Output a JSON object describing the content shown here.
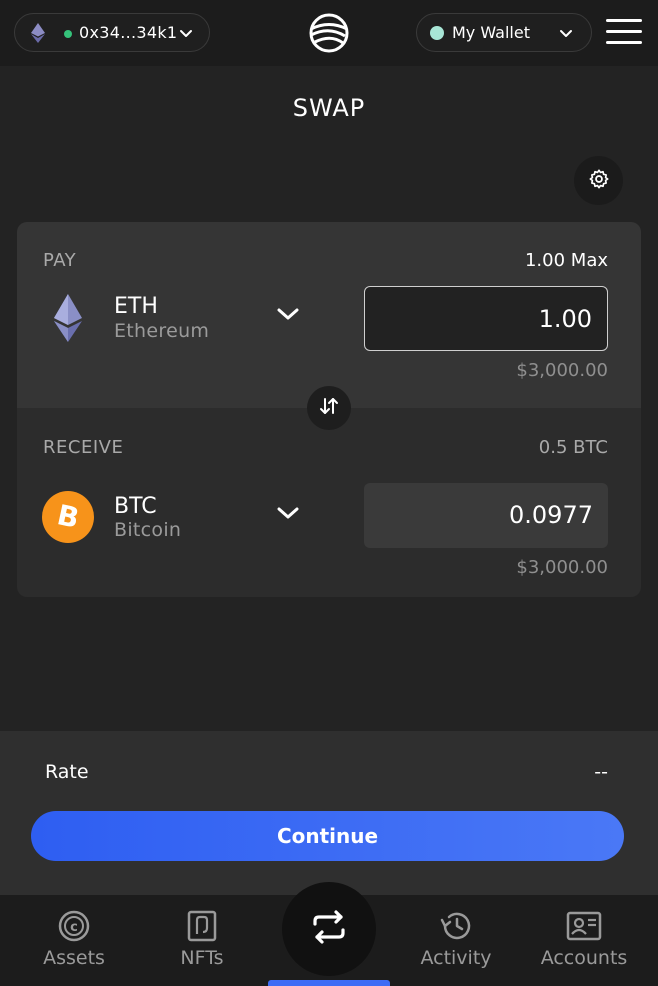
{
  "header": {
    "network_icon": "ethereum-icon",
    "address": "0x34...34k1",
    "logo_icon": "wave-logo-icon",
    "wallet_name": "My Wallet",
    "menu_icon": "hamburger-menu-icon"
  },
  "title": "SWAP",
  "settings_icon": "gear-icon",
  "pay": {
    "label": "PAY",
    "balance": "1.00 Max",
    "token_symbol": "ETH",
    "token_name": "Ethereum",
    "amount": "1.00",
    "usd_value": "$3,000.00"
  },
  "receive": {
    "label": "RECEIVE",
    "balance": "0.5 BTC",
    "token_symbol": "BTC",
    "token_name": "Bitcoin",
    "amount": "0.0977",
    "usd_value": "$3,000.00"
  },
  "rate": {
    "label": "Rate",
    "value": "--"
  },
  "continue_label": "Continue",
  "tabs": [
    {
      "label": "Assets",
      "icon": "coin-icon"
    },
    {
      "label": "NFTs",
      "icon": "nft-card-icon"
    },
    {
      "label": "",
      "icon": "swap-arrows-icon"
    },
    {
      "label": "Activity",
      "icon": "history-icon"
    },
    {
      "label": "Accounts",
      "icon": "accounts-icon"
    }
  ],
  "colors": {
    "accent": "#3d6cf5",
    "status_dot": "#35c27a",
    "wallet_dot": "#a8e6d6",
    "btc_orange": "#f7931a"
  }
}
